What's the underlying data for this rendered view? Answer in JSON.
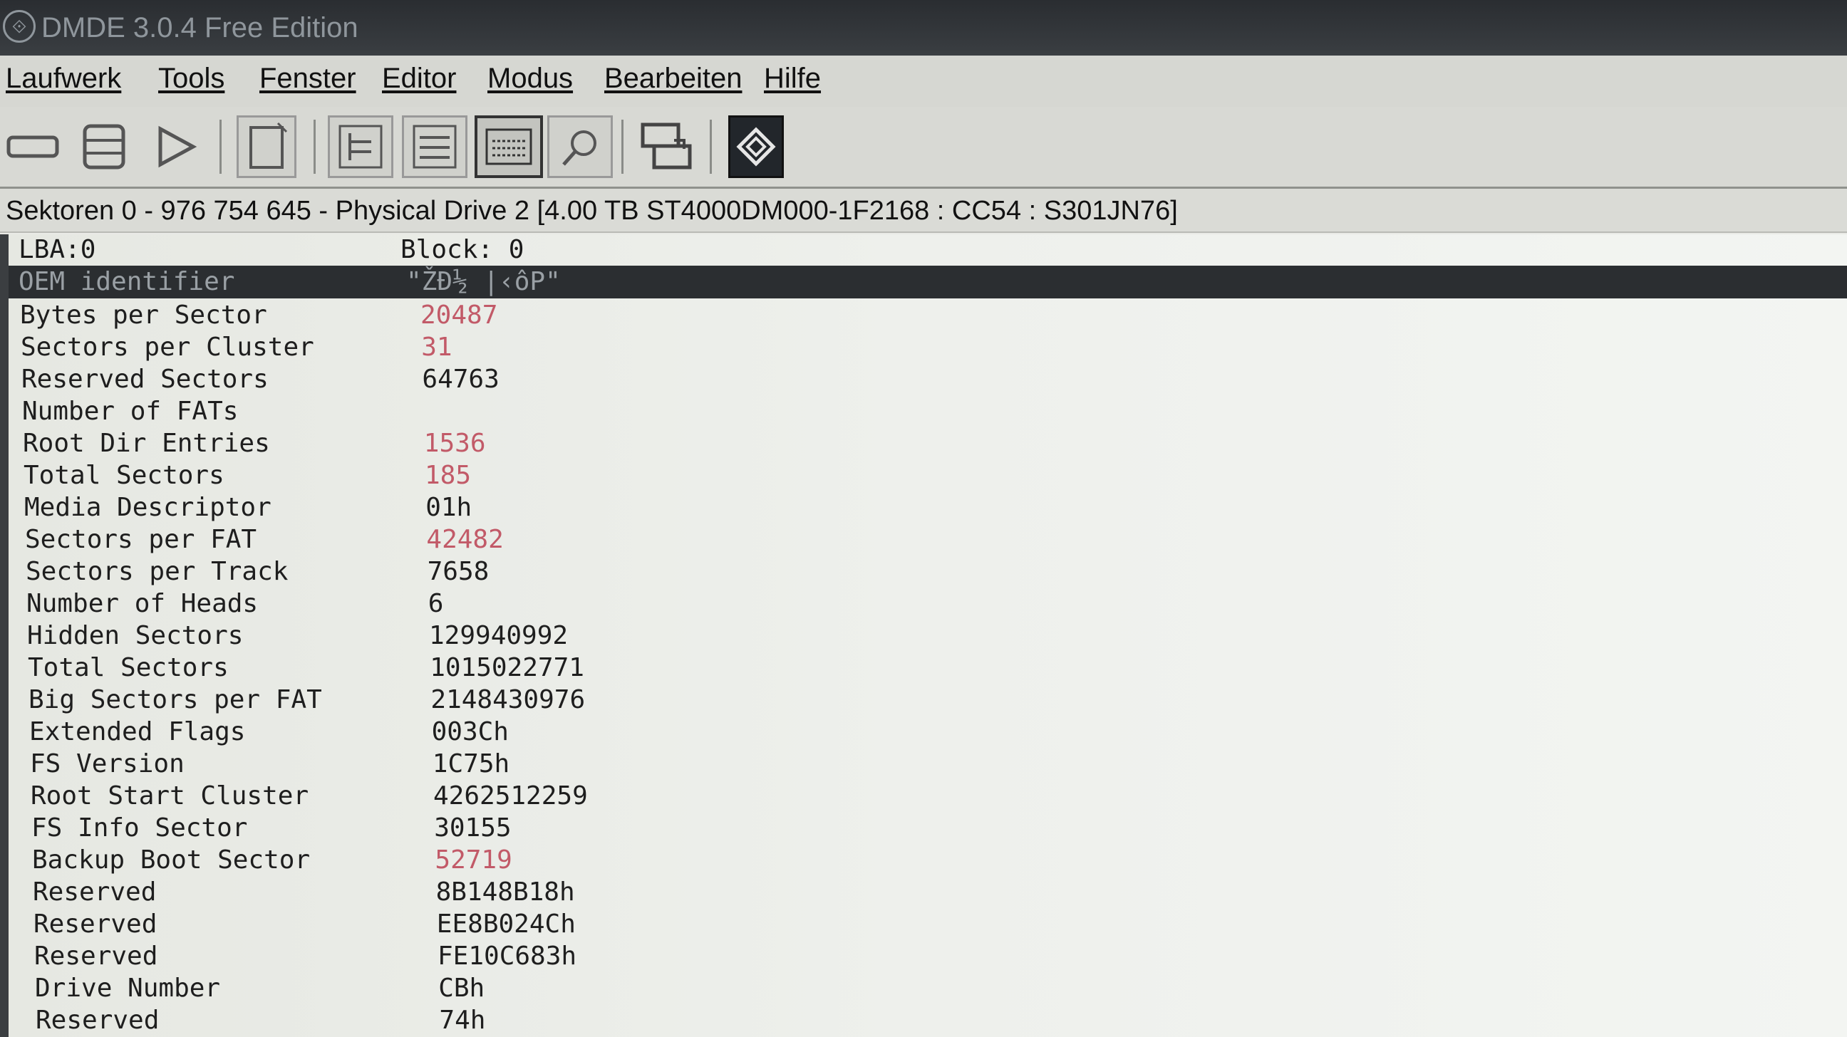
{
  "window": {
    "title": "DMDE 3.0.4 Free Edition"
  },
  "menu": [
    "Laufwerk",
    "Tools",
    "Fenster",
    "Editor",
    "Modus",
    "Bearbeiten",
    "Hilfe"
  ],
  "toolbar": {
    "icons": [
      "drive-icon",
      "partitions-icon",
      "play-icon",
      "new-file-icon",
      "tree-view-icon",
      "list-view-icon",
      "hex-view-icon",
      "search-icon",
      "copy-sectors-icon",
      "dmde-logo-icon"
    ],
    "active": "hex-view-icon"
  },
  "info": {
    "text": "Sektoren 0 - 976 754 645 - Physical Drive 2 [4.00 TB ST4000DM000-1F2168 : CC54 : S301JN76]"
  },
  "header": {
    "lba": "LBA:0",
    "block": "Block: 0"
  },
  "selected": {
    "name": "OEM identifier",
    "value": "\"ŽĐ½ |‹ôP\""
  },
  "fields": [
    {
      "name": "Bytes per Sector",
      "value": "20487",
      "highlight": true
    },
    {
      "name": "Sectors per Cluster",
      "value": "31",
      "highlight": true
    },
    {
      "name": "Reserved Sectors",
      "value": "64763",
      "highlight": false
    },
    {
      "name": "Number of FATs",
      "value": "",
      "highlight": false
    },
    {
      "name": "Root Dir Entries",
      "value": "1536",
      "highlight": true
    },
    {
      "name": "Total Sectors",
      "value": "185",
      "highlight": true
    },
    {
      "name": "Media Descriptor",
      "value": "01h",
      "highlight": false
    },
    {
      "name": "Sectors per FAT",
      "value": "42482",
      "highlight": true
    },
    {
      "name": "Sectors per Track",
      "value": "7658",
      "highlight": false
    },
    {
      "name": "Number of Heads",
      "value": "6",
      "highlight": false
    },
    {
      "name": "Hidden Sectors",
      "value": "129940992",
      "highlight": false
    },
    {
      "name": "Total Sectors",
      "value": "1015022771",
      "highlight": false
    },
    {
      "name": "Big Sectors per FAT",
      "value": "2148430976",
      "highlight": false
    },
    {
      "name": "Extended Flags",
      "value": "003Ch",
      "highlight": false
    },
    {
      "name": "FS Version",
      "value": "1C75h",
      "highlight": false
    },
    {
      "name": "Root Start Cluster",
      "value": "4262512259",
      "highlight": false
    },
    {
      "name": "FS Info Sector",
      "value": "30155",
      "highlight": false
    },
    {
      "name": "Backup Boot Sector",
      "value": "52719",
      "highlight": true
    },
    {
      "name": "Reserved",
      "value": "8B148B18h",
      "highlight": false
    },
    {
      "name": "Reserved",
      "value": "EE8B024Ch",
      "highlight": false
    },
    {
      "name": "Reserved",
      "value": "FE10C683h",
      "highlight": false
    },
    {
      "name": "Drive Number",
      "value": "CBh",
      "highlight": false
    },
    {
      "name": "Reserved",
      "value": "74h",
      "highlight": false
    }
  ]
}
